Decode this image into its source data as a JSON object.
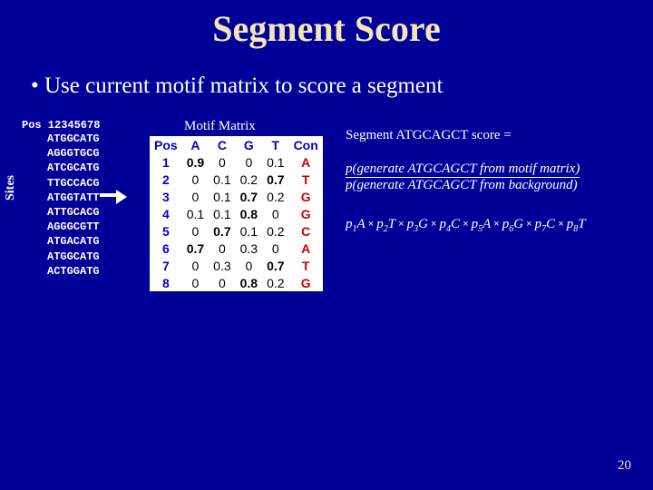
{
  "title": "Segment Score",
  "bullet": "•  Use current motif matrix to score a segment",
  "sites_label": "Sites",
  "pos_header": "Pos 12345678",
  "sequences": [
    "ATGGCATG",
    "AGGGTGCG",
    "ATCGCATG",
    "TTGCCACG",
    "ATGGTATT",
    "ATTGCACG",
    "AGGGCGTT",
    "ATGACATG",
    "ATGGCATG",
    "ACTGGATG"
  ],
  "matrix_label": "Motif Matrix",
  "matrix": {
    "headers": [
      "Pos",
      "A",
      "C",
      "G",
      "T",
      "Con"
    ],
    "rows": [
      {
        "pos": 1,
        "A": 0.9,
        "C": 0,
        "G": 0,
        "T": 0.1,
        "con": "A",
        "maxcol": "A"
      },
      {
        "pos": 2,
        "A": 0,
        "C": 0.1,
        "G": 0.2,
        "T": 0.7,
        "con": "T",
        "maxcol": "T"
      },
      {
        "pos": 3,
        "A": 0,
        "C": 0.1,
        "G": 0.7,
        "T": 0.2,
        "con": "G",
        "maxcol": "G"
      },
      {
        "pos": 4,
        "A": 0.1,
        "C": 0.1,
        "G": 0.8,
        "T": 0,
        "con": "G",
        "maxcol": "G"
      },
      {
        "pos": 5,
        "A": 0,
        "C": 0.7,
        "G": 0.1,
        "T": 0.2,
        "con": "C",
        "maxcol": "C"
      },
      {
        "pos": 6,
        "A": 0.7,
        "C": 0,
        "G": 0.3,
        "T": 0,
        "con": "A",
        "maxcol": "A"
      },
      {
        "pos": 7,
        "A": 0,
        "C": 0.3,
        "G": 0,
        "T": 0.7,
        "con": "T",
        "maxcol": "T"
      },
      {
        "pos": 8,
        "A": 0,
        "C": 0,
        "G": 0.8,
        "T": 0.2,
        "con": "G",
        "maxcol": "G"
      }
    ]
  },
  "score": {
    "line1": "Segment ATGCAGCT score =",
    "num": "p(generate ATGCAGCT from motif matrix)",
    "den": "p(generate ATGCAGCT from background)"
  },
  "prob_terms": [
    "p₁A",
    "p₂T",
    "p₃G",
    "p₄C",
    "p₅A",
    "p₆G",
    "p₇C",
    "p₈T"
  ],
  "slide_num": "20"
}
